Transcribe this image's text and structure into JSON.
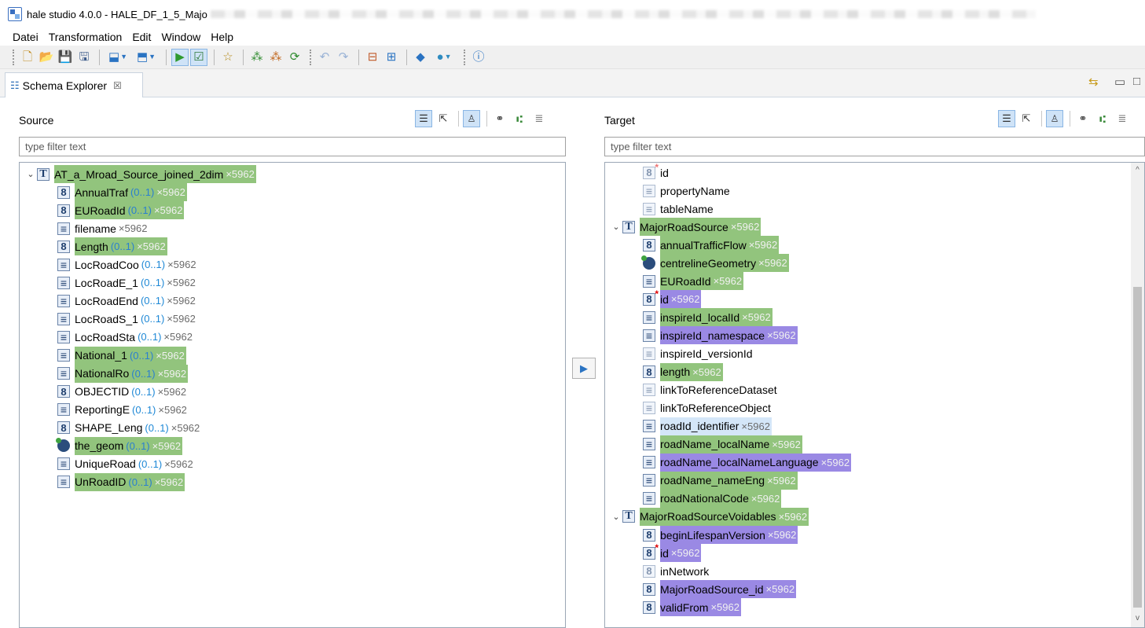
{
  "window": {
    "title": "hale studio 4.0.0 - HALE_DF_1_5_Majo"
  },
  "menu": [
    "Datei",
    "Transformation",
    "Edit",
    "Window",
    "Help"
  ],
  "tab": {
    "label": "Schema Explorer",
    "close": "☒"
  },
  "source": {
    "title": "Source",
    "filter_placeholder": "type filter text",
    "rows": [
      {
        "type": "T",
        "label": "AT_a_Mroad_Source_joined_2dim",
        "card": "",
        "count": "×5962",
        "hl": "green",
        "level": 0,
        "expand": "⌄"
      },
      {
        "type": "8",
        "label": "AnnualTraf",
        "card": "(0..1)",
        "count": "×5962",
        "hl": "green",
        "level": 1
      },
      {
        "type": "8",
        "label": "EURoadId",
        "card": "(0..1)",
        "count": "×5962",
        "hl": "green",
        "level": 1
      },
      {
        "type": "≡",
        "label": "filename",
        "card": "",
        "count": "×5962",
        "hl": "",
        "level": 1
      },
      {
        "type": "8",
        "label": "Length",
        "card": "(0..1)",
        "count": "×5962",
        "hl": "green",
        "level": 1
      },
      {
        "type": "≡",
        "label": "LocRoadCoo",
        "card": "(0..1)",
        "count": "×5962",
        "hl": "",
        "level": 1
      },
      {
        "type": "≡",
        "label": "LocRoadE_1",
        "card": "(0..1)",
        "count": "×5962",
        "hl": "",
        "level": 1
      },
      {
        "type": "≡",
        "label": "LocRoadEnd",
        "card": "(0..1)",
        "count": "×5962",
        "hl": "",
        "level": 1
      },
      {
        "type": "≡",
        "label": "LocRoadS_1",
        "card": "(0..1)",
        "count": "×5962",
        "hl": "",
        "level": 1
      },
      {
        "type": "≡",
        "label": "LocRoadSta",
        "card": "(0..1)",
        "count": "×5962",
        "hl": "",
        "level": 1
      },
      {
        "type": "≡",
        "label": "National_1",
        "card": "(0..1)",
        "count": "×5962",
        "hl": "green",
        "level": 1
      },
      {
        "type": "≡",
        "label": "NationalRo",
        "card": "(0..1)",
        "count": "×5962",
        "hl": "green",
        "level": 1
      },
      {
        "type": "8",
        "label": "OBJECTID",
        "card": "(0..1)",
        "count": "×5962",
        "hl": "",
        "level": 1
      },
      {
        "type": "≡",
        "label": "ReportingE",
        "card": "(0..1)",
        "count": "×5962",
        "hl": "",
        "level": 1
      },
      {
        "type": "8",
        "label": "SHAPE_Leng",
        "card": "(0..1)",
        "count": "×5962",
        "hl": "",
        "level": 1
      },
      {
        "type": "geo",
        "label": "the_geom",
        "card": "(0..1)",
        "count": "×5962",
        "hl": "green",
        "level": 1
      },
      {
        "type": "≡",
        "label": "UniqueRoad",
        "card": "(0..1)",
        "count": "×5962",
        "hl": "",
        "level": 1
      },
      {
        "type": "≡",
        "label": "UnRoadID",
        "card": "(0..1)",
        "count": "×5962",
        "hl": "green",
        "level": 1
      }
    ]
  },
  "target": {
    "title": "Target",
    "filter_placeholder": "type filter text",
    "rows": [
      {
        "type": "8",
        "req": true,
        "faded": true,
        "label": "id",
        "card": "",
        "count": "",
        "hl": "",
        "level": 1
      },
      {
        "type": "≡",
        "faded": true,
        "label": "propertyName",
        "card": "",
        "count": "",
        "hl": "",
        "level": 1
      },
      {
        "type": "≡",
        "faded": true,
        "label": "tableName",
        "card": "",
        "count": "",
        "hl": "",
        "level": 1
      },
      {
        "type": "T",
        "label": "MajorRoadSource",
        "card": "",
        "count": "×5962",
        "hl": "green",
        "level": 0,
        "expand": "⌄"
      },
      {
        "type": "8",
        "label": "annualTrafficFlow",
        "card": "",
        "count": "×5962",
        "hl": "green",
        "level": 1
      },
      {
        "type": "geo",
        "label": "centrelineGeometry",
        "card": "",
        "count": "×5962",
        "hl": "green",
        "level": 1
      },
      {
        "type": "≡",
        "label": "EURoadId",
        "card": "",
        "count": "×5962",
        "hl": "green",
        "level": 1
      },
      {
        "type": "8",
        "req": true,
        "label": "id",
        "card": "",
        "count": "×5962",
        "hl": "purple",
        "level": 1
      },
      {
        "type": "≡",
        "label": "inspireId_localId",
        "card": "",
        "count": "×5962",
        "hl": "green",
        "level": 1
      },
      {
        "type": "≡",
        "label": "inspireId_namespace",
        "card": "",
        "count": "×5962",
        "hl": "purple",
        "level": 1
      },
      {
        "type": "≡",
        "faded": true,
        "label": "inspireId_versionId",
        "card": "",
        "count": "",
        "hl": "",
        "level": 1
      },
      {
        "type": "8",
        "label": "length",
        "card": "",
        "count": "×5962",
        "hl": "green",
        "level": 1
      },
      {
        "type": "≡",
        "faded": true,
        "label": "linkToReferenceDataset",
        "card": "",
        "count": "",
        "hl": "",
        "level": 1
      },
      {
        "type": "≡",
        "faded": true,
        "label": "linkToReferenceObject",
        "card": "",
        "count": "",
        "hl": "",
        "level": 1
      },
      {
        "type": "≡",
        "label": "roadId_identifier",
        "card": "",
        "count": "×5962",
        "hl": "blue",
        "level": 1
      },
      {
        "type": "≡",
        "label": "roadName_localName",
        "card": "",
        "count": "×5962",
        "hl": "green",
        "level": 1
      },
      {
        "type": "≡",
        "label": "roadName_localNameLanguage",
        "card": "",
        "count": "×5962",
        "hl": "purple",
        "level": 1
      },
      {
        "type": "≡",
        "label": "roadName_nameEng",
        "card": "",
        "count": "×5962",
        "hl": "green",
        "level": 1
      },
      {
        "type": "≡",
        "label": "roadNationalCode",
        "card": "",
        "count": "×5962",
        "hl": "green",
        "level": 1
      },
      {
        "type": "T",
        "label": "MajorRoadSourceVoidables",
        "card": "",
        "count": "×5962",
        "hl": "green",
        "level": 0,
        "expand": "⌄"
      },
      {
        "type": "8",
        "label": "beginLifespanVersion",
        "card": "",
        "count": "×5962",
        "hl": "purple",
        "level": 1
      },
      {
        "type": "8",
        "req": true,
        "label": "id",
        "card": "",
        "count": "×5962",
        "hl": "purple",
        "level": 1
      },
      {
        "type": "8",
        "faded": true,
        "label": "inNetwork",
        "card": "",
        "count": "",
        "hl": "",
        "level": 1
      },
      {
        "type": "8",
        "label": "MajorRoadSource_id",
        "card": "",
        "count": "×5962",
        "hl": "purple",
        "level": 1
      },
      {
        "type": "8",
        "label": "validFrom",
        "card": "",
        "count": "×5962",
        "hl": "purple",
        "level": 1
      }
    ]
  },
  "colors": {
    "mapped_green": "#92c47d",
    "mapped_purple": "#9a89e4",
    "selected_blue": "#d4e6f8",
    "accent": "#2a73c2"
  },
  "icons": {
    "toolbar": [
      "new-file-icon",
      "open-folder-icon",
      "save-icon",
      "save-all-icon",
      "import-icon",
      "export-icon",
      "run-transformation-icon",
      "validate-icon",
      "favorite-icon",
      "cluster-icon",
      "cluster-edit-icon",
      "refresh-icon",
      "undo-icon",
      "redo-icon",
      "alignment-icon",
      "alignment-edit-icon",
      "forward-icon",
      "globe-icon",
      "help-icon"
    ],
    "arrow": "▶"
  }
}
